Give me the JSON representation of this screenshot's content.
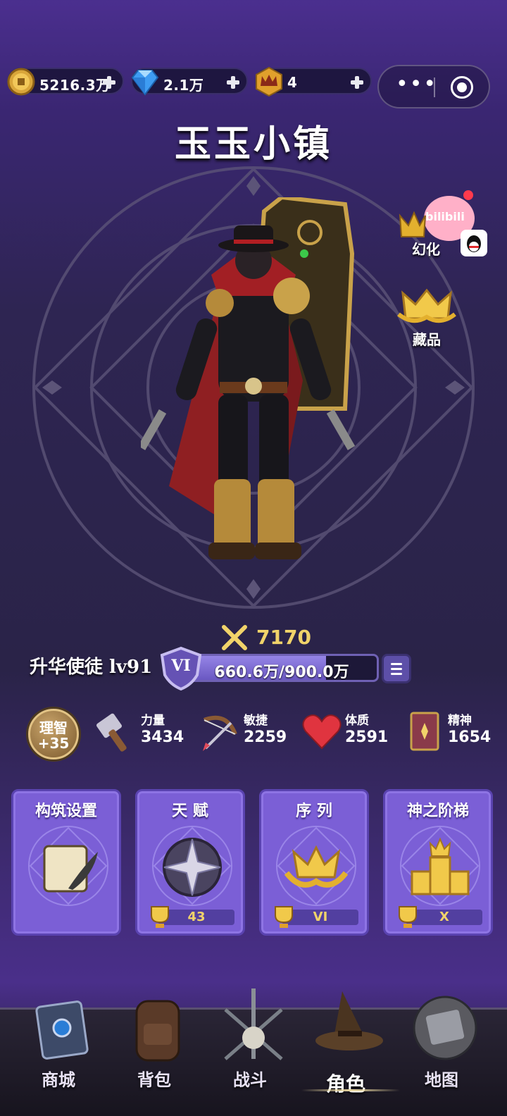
{
  "currencies": [
    {
      "name": "coin",
      "amount": "5216.3万"
    },
    {
      "name": "diamond",
      "amount": "2.1万"
    },
    {
      "name": "crown-token",
      "amount": "4"
    }
  ],
  "mini_program_capsule": {
    "menu_glyph": "•••"
  },
  "town_title": "玉玉小镇",
  "side_buttons": {
    "transform_label": "幻化",
    "collection_label": "藏品",
    "bilibili_label": "bilibili"
  },
  "power": {
    "value": "7170"
  },
  "rank": {
    "name": "升华使徒 lv91",
    "tier": "VI",
    "exp_text": "660.6万/900.0万",
    "exp_fraction": 0.734
  },
  "sanity": {
    "label": "理智",
    "value": "+35"
  },
  "stats": [
    {
      "name": "力量",
      "value": "3434"
    },
    {
      "name": "敏捷",
      "value": "2259"
    },
    {
      "name": "体质",
      "value": "2591"
    },
    {
      "name": "精神",
      "value": "1654"
    }
  ],
  "cards": [
    {
      "title": "构筑设置",
      "badge": ""
    },
    {
      "title": "天 赋",
      "badge": "43"
    },
    {
      "title": "序 列",
      "badge": "VI"
    },
    {
      "title": "神之阶梯",
      "badge": "X"
    }
  ],
  "nav": [
    {
      "label": "商城"
    },
    {
      "label": "背包"
    },
    {
      "label": "战斗"
    },
    {
      "label": "角色"
    },
    {
      "label": "地图"
    }
  ],
  "colors": {
    "accent_gold": "#f1d36a",
    "card_purple": "#7b5fd6",
    "bg_purple": "#2e2552"
  }
}
